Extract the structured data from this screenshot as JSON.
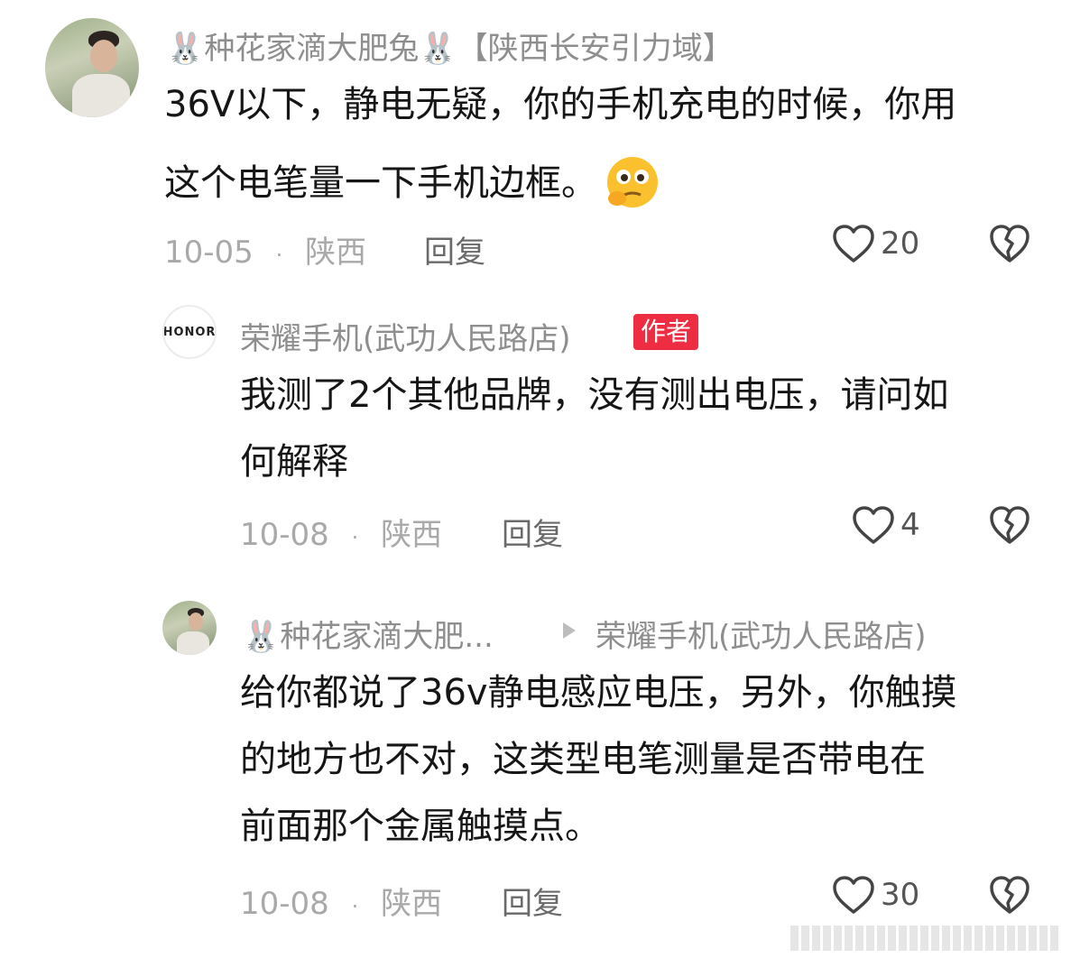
{
  "comments": [
    {
      "name": "种花家滴大肥兔",
      "name_suffix": "【陕西长安引力域】",
      "text_line1": "36V以下，静电无疑，你的手机充电的时候，你用",
      "text_line2": "这个电笔量一下手机边框。",
      "date": "10-05",
      "separator": "·",
      "location": "陕西",
      "reply_label": "回复",
      "likes": "20"
    },
    {
      "name": "荣耀手机(武功人民路店)",
      "author_badge": "作者",
      "avatar_logo": "HONOR",
      "text_line1": "我测了2个其他品牌，没有测出电压，请问如",
      "text_line2": "何解释",
      "date": "10-08",
      "separator": "·",
      "location": "陕西",
      "reply_label": "回复",
      "likes": "4"
    },
    {
      "name": "种花家滴大肥...",
      "reply_to": "荣耀手机(武功人民路店)",
      "text_line1": "给你都说了36v静电感应电压，另外，你触摸",
      "text_line2": "的地方也不对，这类型电笔测量是否带电在",
      "text_line3": "前面那个金属触摸点。",
      "date": "10-08",
      "separator": "·",
      "location": "陕西",
      "reply_label": "回复",
      "likes": "30"
    }
  ],
  "icons": {
    "rabbit": "rabbit-icon",
    "emoji": "thinking-face-icon",
    "heart": "heart-icon",
    "dislike": "broken-heart-icon",
    "reply_arrow": "play-arrow-icon"
  },
  "colors": {
    "badge": "#ee2d42",
    "name": "#8e8e8e",
    "meta": "#a9a9a9"
  }
}
